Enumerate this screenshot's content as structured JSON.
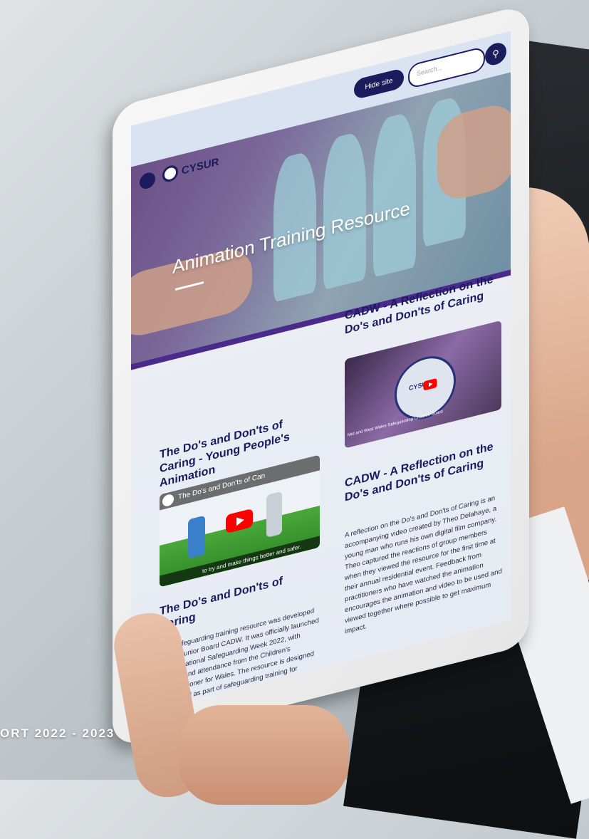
{
  "report_footer": "ORT 2022 - 2023",
  "site": {
    "brand": "CYSUR",
    "hide_site_label": "Hide site",
    "search_placeholder": "Search..."
  },
  "hero": {
    "title": "Animation Training Resource"
  },
  "cards": {
    "left_video_title": "The Do's and Don'ts of Caring - Young People's Animation",
    "left_video_overlay": "The Do's and Don'ts of Can",
    "left_video_caption": "to try and make things better and safer.",
    "left_text_title": "The Do's and Don'ts of Caring",
    "left_text_body": "This safeguarding training resource was developed by our Junior Board CADW. It was officially launched during National Safeguarding Week 2022, with support and attendance from the Children's Commissioner for Wales. The resource is designed to be used as part of safeguarding training for practitioners. To download for your use or to insert into your own training resources please use the links below.",
    "right_video_title": "CADW - A Reflection on the Do's and Don'ts of Caring",
    "right_video_logo": "CYSUR",
    "right_video_ring_text": "Mid and West Wales Safeguarding Children Board",
    "right_text_title": "CADW - A Reflection on the Do's and Don'ts of Caring",
    "right_text_body": "A reflection on the Do's and Don'ts of Caring is an accompanying video created by Theo Delahaye, a young man who runs his own digital film company. Theo captured the reactions of group members when they viewed the resource for the first time at their annual residential event. Feedback from practitioners who have watched the animation encourages the animation and video to be used and viewed together where possible to get maximum impact."
  },
  "colors": {
    "navy": "#1b1b5e",
    "purple_stripe": "#4a2b8c",
    "play_red": "#ff0000"
  }
}
